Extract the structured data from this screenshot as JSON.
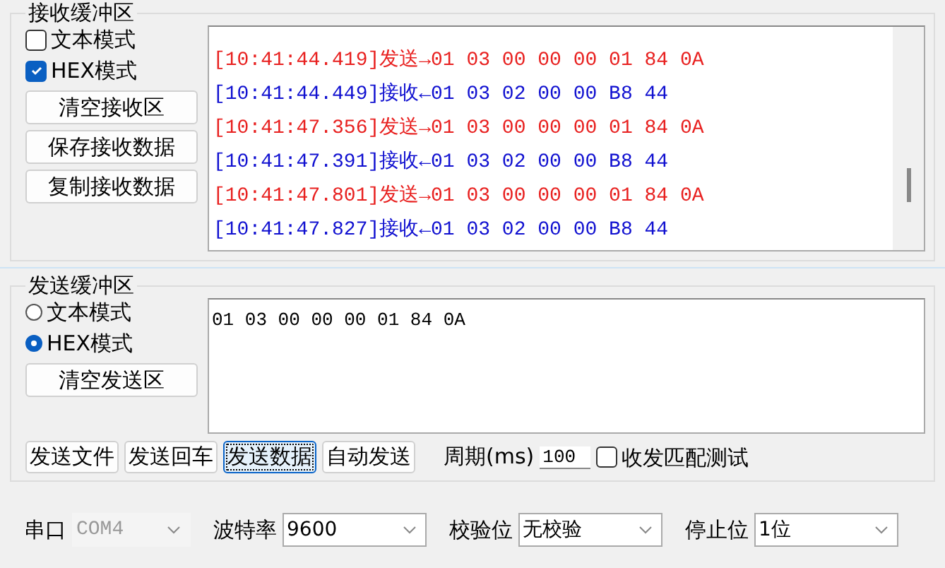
{
  "receive": {
    "title": "接收缓冲区",
    "modes": [
      {
        "label": "文本模式",
        "checked": false
      },
      {
        "label": "HEX模式",
        "checked": true
      }
    ],
    "buttons": [
      "清空接收区",
      "保存接收数据",
      "复制接收数据"
    ],
    "log": [
      {
        "kind": "send",
        "text": "[10:41:44.419]发送→01 03 00 00 00 01 84 0A"
      },
      {
        "kind": "recv",
        "text": "[10:41:44.449]接收←01 03 02 00 00 B8 44"
      },
      {
        "kind": "send",
        "text": "[10:41:47.356]发送→01 03 00 00 00 01 84 0A"
      },
      {
        "kind": "recv",
        "text": "[10:41:47.391]接收←01 03 02 00 00 B8 44"
      },
      {
        "kind": "send",
        "text": "[10:41:47.801]发送→01 03 00 00 00 01 84 0A"
      },
      {
        "kind": "recv",
        "text": "[10:41:47.827]接收←01 03 02 00 00 B8 44"
      }
    ]
  },
  "send": {
    "title": "发送缓冲区",
    "modes": [
      {
        "label": "文本模式",
        "selected": false
      },
      {
        "label": "HEX模式",
        "selected": true
      }
    ],
    "clear_button": "清空发送区",
    "content": "01 03 00 00 00 01 84 0A",
    "buttons": [
      {
        "label": "发送文件",
        "focused": false
      },
      {
        "label": "发送回车",
        "focused": false
      },
      {
        "label": "发送数据",
        "focused": true
      },
      {
        "label": "自动发送",
        "focused": false
      }
    ],
    "period_label": "周期(ms)",
    "period_value": "100",
    "match_test": {
      "label": "收发匹配测试",
      "checked": false
    }
  },
  "serial": [
    {
      "label": "串口",
      "value": "COM4",
      "disabled": true
    },
    {
      "label": "波特率",
      "value": "9600",
      "disabled": false
    },
    {
      "label": "校验位",
      "value": "无校验",
      "disabled": false
    },
    {
      "label": "停止位",
      "value": "1位",
      "disabled": false
    }
  ]
}
